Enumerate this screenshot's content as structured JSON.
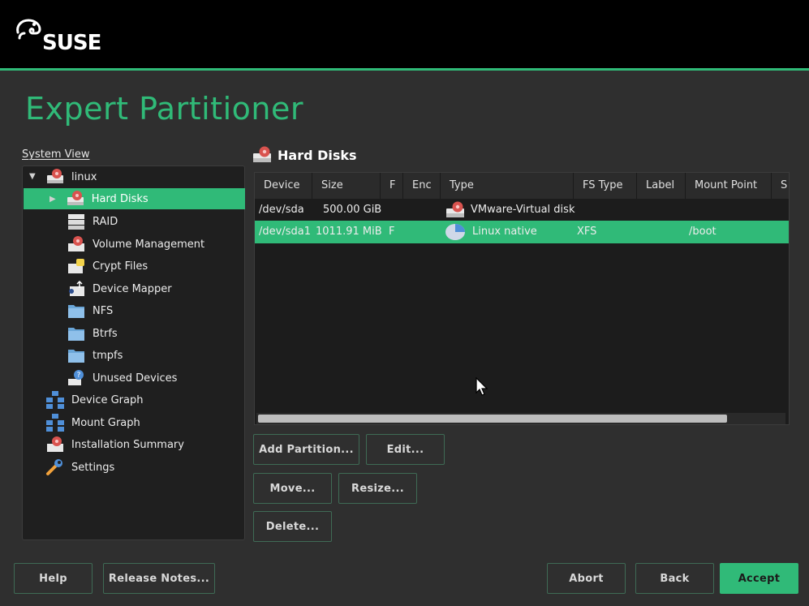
{
  "brand": {
    "logo_text": "SUSE"
  },
  "page": {
    "title": "Expert Partitioner"
  },
  "system_view": {
    "label": "System View",
    "items": [
      {
        "label": "linux",
        "icon": "hard-disk-icon"
      },
      {
        "label": "Hard Disks",
        "icon": "hard-disk-icon",
        "selected": true
      },
      {
        "label": "RAID",
        "icon": "raid-icon"
      },
      {
        "label": "Volume Management",
        "icon": "volume-icon"
      },
      {
        "label": "Crypt Files",
        "icon": "crypt-icon"
      },
      {
        "label": "Device Mapper",
        "icon": "device-mapper-icon"
      },
      {
        "label": "NFS",
        "icon": "folder-icon"
      },
      {
        "label": "Btrfs",
        "icon": "folder-icon"
      },
      {
        "label": "tmpfs",
        "icon": "folder-icon"
      },
      {
        "label": "Unused Devices",
        "icon": "unused-devices-icon"
      },
      {
        "label": "Device Graph",
        "icon": "graph-icon"
      },
      {
        "label": "Mount Graph",
        "icon": "graph-icon"
      },
      {
        "label": "Installation Summary",
        "icon": "summary-icon"
      },
      {
        "label": "Settings",
        "icon": "wrench-icon"
      }
    ]
  },
  "hard_disks": {
    "title": "Hard Disks",
    "columns": [
      "Device",
      "Size",
      "F",
      "Enc",
      "Type",
      "FS Type",
      "Label",
      "Mount Point",
      "S"
    ],
    "rows": [
      {
        "device": "/dev/sda",
        "size": "500.00 GiB",
        "f": "",
        "enc": "",
        "type": "VMware-Virtual disk",
        "fs_type": "",
        "label": "",
        "mount": ""
      },
      {
        "device": "/dev/sda1",
        "size": "1011.91 MiB",
        "f": "F",
        "enc": "",
        "type": "Linux native",
        "fs_type": "XFS",
        "label": "",
        "mount": "/boot"
      }
    ]
  },
  "buttons": {
    "add_partition": "Add Partition...",
    "edit": "Edit...",
    "move": "Move...",
    "resize": "Resize...",
    "delete": "Delete...",
    "help": "Help",
    "release_notes": "Release Notes...",
    "abort": "Abort",
    "back": "Back",
    "accept": "Accept"
  },
  "colors": {
    "accent": "#30ba78",
    "background": "#2f2f2f",
    "topbar": "#000000"
  }
}
